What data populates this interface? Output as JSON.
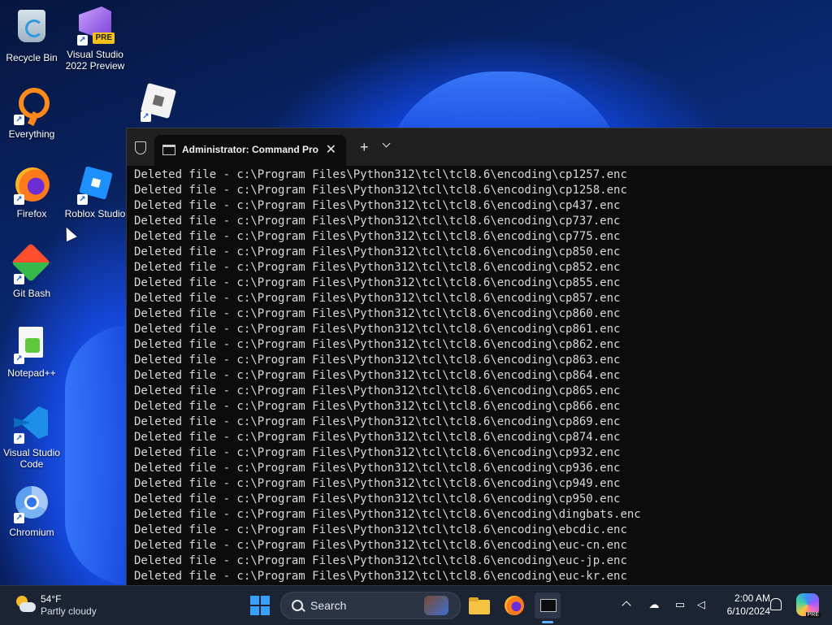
{
  "desktop": {
    "icons": [
      {
        "label": "Recycle Bin",
        "icon": "recycle-bin-icon"
      },
      {
        "label": "Visual Studio\n2022 Preview",
        "icon": "visual-studio-icon",
        "badge": "PRE"
      },
      {
        "label": "Everything",
        "icon": "everything-search-icon"
      },
      {
        "label": "Firefox",
        "icon": "firefox-icon"
      },
      {
        "label": "Roblox Studio",
        "icon": "roblox-studio-icon"
      },
      {
        "label": "Git Bash",
        "icon": "git-bash-icon"
      },
      {
        "label": "Notepad++",
        "icon": "notepad-plus-plus-icon"
      },
      {
        "label": "Visual Studio\nCode",
        "icon": "vscode-icon"
      },
      {
        "label": "Chromium",
        "icon": "chromium-icon"
      }
    ]
  },
  "terminal": {
    "tab_title": "Administrator: Command Pro",
    "close_symbol": "✕",
    "new_tab_symbol": "+",
    "lines": [
      "Deleted file - c:\\Program Files\\Python312\\tcl\\tcl8.6\\encoding\\cp1257.enc",
      "Deleted file - c:\\Program Files\\Python312\\tcl\\tcl8.6\\encoding\\cp1258.enc",
      "Deleted file - c:\\Program Files\\Python312\\tcl\\tcl8.6\\encoding\\cp437.enc",
      "Deleted file - c:\\Program Files\\Python312\\tcl\\tcl8.6\\encoding\\cp737.enc",
      "Deleted file - c:\\Program Files\\Python312\\tcl\\tcl8.6\\encoding\\cp775.enc",
      "Deleted file - c:\\Program Files\\Python312\\tcl\\tcl8.6\\encoding\\cp850.enc",
      "Deleted file - c:\\Program Files\\Python312\\tcl\\tcl8.6\\encoding\\cp852.enc",
      "Deleted file - c:\\Program Files\\Python312\\tcl\\tcl8.6\\encoding\\cp855.enc",
      "Deleted file - c:\\Program Files\\Python312\\tcl\\tcl8.6\\encoding\\cp857.enc",
      "Deleted file - c:\\Program Files\\Python312\\tcl\\tcl8.6\\encoding\\cp860.enc",
      "Deleted file - c:\\Program Files\\Python312\\tcl\\tcl8.6\\encoding\\cp861.enc",
      "Deleted file - c:\\Program Files\\Python312\\tcl\\tcl8.6\\encoding\\cp862.enc",
      "Deleted file - c:\\Program Files\\Python312\\tcl\\tcl8.6\\encoding\\cp863.enc",
      "Deleted file - c:\\Program Files\\Python312\\tcl\\tcl8.6\\encoding\\cp864.enc",
      "Deleted file - c:\\Program Files\\Python312\\tcl\\tcl8.6\\encoding\\cp865.enc",
      "Deleted file - c:\\Program Files\\Python312\\tcl\\tcl8.6\\encoding\\cp866.enc",
      "Deleted file - c:\\Program Files\\Python312\\tcl\\tcl8.6\\encoding\\cp869.enc",
      "Deleted file - c:\\Program Files\\Python312\\tcl\\tcl8.6\\encoding\\cp874.enc",
      "Deleted file - c:\\Program Files\\Python312\\tcl\\tcl8.6\\encoding\\cp932.enc",
      "Deleted file - c:\\Program Files\\Python312\\tcl\\tcl8.6\\encoding\\cp936.enc",
      "Deleted file - c:\\Program Files\\Python312\\tcl\\tcl8.6\\encoding\\cp949.enc",
      "Deleted file - c:\\Program Files\\Python312\\tcl\\tcl8.6\\encoding\\cp950.enc",
      "Deleted file - c:\\Program Files\\Python312\\tcl\\tcl8.6\\encoding\\dingbats.enc",
      "Deleted file - c:\\Program Files\\Python312\\tcl\\tcl8.6\\encoding\\ebcdic.enc",
      "Deleted file - c:\\Program Files\\Python312\\tcl\\tcl8.6\\encoding\\euc-cn.enc",
      "Deleted file - c:\\Program Files\\Python312\\tcl\\tcl8.6\\encoding\\euc-jp.enc",
      "Deleted file - c:\\Program Files\\Python312\\tcl\\tcl8.6\\encoding\\euc-kr.enc"
    ]
  },
  "taskbar": {
    "weather": {
      "temp": "54°F",
      "condition": "Partly cloudy"
    },
    "search_label": "Search",
    "clock": {
      "time": "2:00 AM",
      "date": "6/10/2024"
    },
    "apps": [
      "start-icon",
      "file-explorer-icon",
      "firefox-icon",
      "terminal-icon"
    ],
    "copilot_badge": "PRE"
  },
  "colors": {
    "terminal_bg": "#0c0c0c",
    "terminal_text": "#d8d8d8",
    "tabbar_bg": "#202020",
    "taskbar_bg": "#1c2433",
    "accent": "#3aa0ff"
  }
}
